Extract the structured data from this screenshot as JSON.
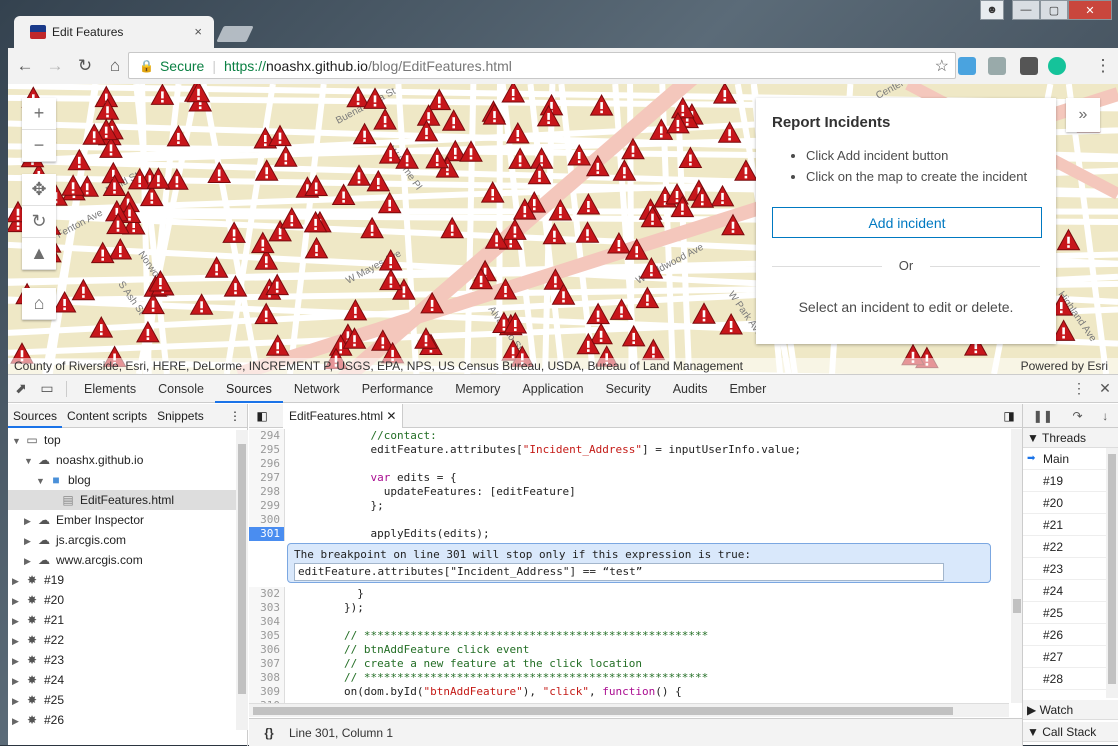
{
  "browser": {
    "tab_title": "Edit Features",
    "tab_close": "×",
    "secure_label": "Secure",
    "url_protocol": "https://",
    "url_host": "noashx.github.io",
    "url_path": "/blog/EditFeatures.html"
  },
  "map": {
    "attribution": "County of Riverside, Esri, HERE, DeLorme, INCREMENT P, USGS, EPA, NPS, US Census Bureau, USDA, Bureau of Land Management",
    "powered_by": "Powered by Esri",
    "street_labels": [
      "Bond St",
      "Norwood St",
      "W Fenton Ave",
      "S Ash St",
      "Buena Vista St",
      "W Home Pl",
      "W Mayes Ave",
      "Alvarado St",
      "W Wildwood Ave",
      "W Park Ave",
      "Center",
      "Highland Ave"
    ],
    "accent_color": "#0079c1",
    "marker_color": "#c7161b"
  },
  "panel": {
    "title": "Report Incidents",
    "instructions": [
      "Click Add incident button",
      "Click on the map to create the incident"
    ],
    "add_button": "Add incident",
    "or_label": "Or",
    "select_text": "Select an incident to edit or delete."
  },
  "devtools": {
    "tabs": [
      "Elements",
      "Console",
      "Sources",
      "Network",
      "Performance",
      "Memory",
      "Application",
      "Security",
      "Audits",
      "Ember"
    ],
    "active_tab": "Sources",
    "navigator_tabs": [
      "Sources",
      "Content scripts",
      "Snippets"
    ],
    "tree": [
      {
        "label": "top",
        "depth": 0,
        "icon": "frame-icon"
      },
      {
        "label": "noashx.github.io",
        "depth": 1,
        "icon": "cloud-icon"
      },
      {
        "label": "blog",
        "depth": 2,
        "icon": "folder-icon"
      },
      {
        "label": "EditFeatures.html",
        "depth": 3,
        "icon": "file-icon"
      },
      {
        "label": "Ember Inspector",
        "depth": 1,
        "icon": "cloud-icon"
      },
      {
        "label": "js.arcgis.com",
        "depth": 1,
        "icon": "cloud-icon"
      },
      {
        "label": "www.arcgis.com",
        "depth": 1,
        "icon": "cloud-icon"
      },
      {
        "label": "#19",
        "depth": 0,
        "icon": "gear-icon"
      },
      {
        "label": "#20",
        "depth": 0,
        "icon": "gear-icon"
      },
      {
        "label": "#21",
        "depth": 0,
        "icon": "gear-icon"
      },
      {
        "label": "#22",
        "depth": 0,
        "icon": "gear-icon"
      },
      {
        "label": "#23",
        "depth": 0,
        "icon": "gear-icon"
      },
      {
        "label": "#24",
        "depth": 0,
        "icon": "gear-icon"
      },
      {
        "label": "#25",
        "depth": 0,
        "icon": "gear-icon"
      },
      {
        "label": "#26",
        "depth": 0,
        "icon": "gear-icon"
      }
    ],
    "editor_file": "EditFeatures.html",
    "code_before": [
      {
        "n": "294",
        "t": "            //contact:"
      },
      {
        "n": "295",
        "t": "            editFeature.attributes[\"Incident_Address\"] = inputUserInfo.value;"
      },
      {
        "n": "296",
        "t": ""
      },
      {
        "n": "297",
        "t": "            var edits = {"
      },
      {
        "n": "298",
        "t": "              updateFeatures: [editFeature]"
      },
      {
        "n": "299",
        "t": "            };"
      },
      {
        "n": "300",
        "t": ""
      },
      {
        "n": "301",
        "t": "            applyEdits(edits);"
      }
    ],
    "breakpoint_message": "The breakpoint on line 301 will stop only if this expression is true:",
    "breakpoint_expression": "editFeature.attributes[\"Incident_Address\"] == “test”",
    "code_after": [
      {
        "n": "302",
        "t": "          }"
      },
      {
        "n": "303",
        "t": "        });"
      },
      {
        "n": "304",
        "t": ""
      },
      {
        "n": "305",
        "t": "        // ****************************************************"
      },
      {
        "n": "306",
        "t": "        // btnAddFeature click event"
      },
      {
        "n": "307",
        "t": "        // create a new feature at the click location"
      },
      {
        "n": "308",
        "t": "        // ****************************************************"
      },
      {
        "n": "309",
        "t": "        on(dom.byId(\"btnAddFeature\"), \"click\", function() {"
      },
      {
        "n": "310",
        "t": "          "
      }
    ],
    "status_icon": "{}",
    "status_text": "Line 301, Column 1",
    "threads_label": "Threads",
    "threads": [
      "Main",
      "#19",
      "#20",
      "#21",
      "#22",
      "#23",
      "#24",
      "#25",
      "#26",
      "#27",
      "#28"
    ],
    "watch_label": "Watch",
    "callstack_label": "Call Stack"
  }
}
